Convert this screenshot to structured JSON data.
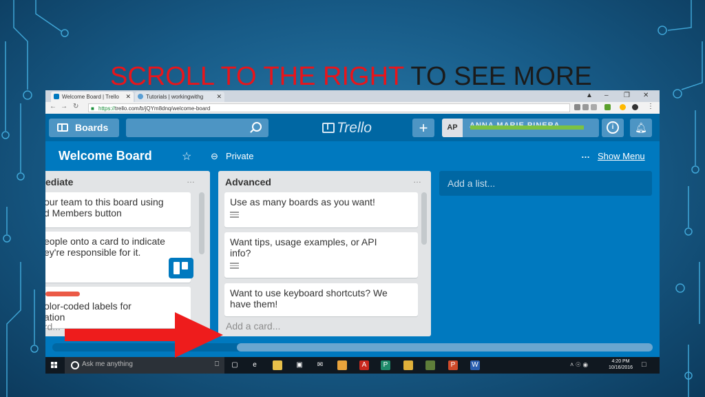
{
  "slide": {
    "title_red": "SCROLL TO THE RIGHT",
    "title_dark": " TO SEE MORE"
  },
  "browser": {
    "tabs": [
      {
        "label": "Welcome Board | Trello",
        "color": "#0079bf"
      },
      {
        "label": "Tutorials | workingwithg",
        "color": "#5a9fd4"
      }
    ],
    "url_scheme": "https://",
    "url_rest": "trello.com/b/jQYm8dnq/welcome-board",
    "window_controls": [
      "–",
      "❐",
      "✕"
    ]
  },
  "trello": {
    "boards_label": "Boards",
    "logo_text": "Trello",
    "plus_label": "+",
    "user_initials": "AP",
    "user_name": "ANNA MARIE PINERA",
    "info_label": "i",
    "bell_label": "⍾"
  },
  "board": {
    "title": "Welcome Board",
    "star": "☆",
    "lock": "ὑ2",
    "visibility": "Private",
    "menu_dots": "…",
    "show_menu": "Show Menu"
  },
  "lists": [
    {
      "title": "ediate",
      "menu": "…",
      "cards": [
        {
          "line1": "our team to this board using",
          "line2": "d Members button"
        },
        {
          "line1": "eople onto a card to indicate",
          "line2": "ey're responsible for it."
        },
        {
          "line1": "olor-coded labels for",
          "line2": "ation"
        }
      ],
      "add_card": "ard..."
    },
    {
      "title": "Advanced",
      "menu": "…",
      "cards": [
        {
          "text": "Use as many boards as you want!"
        },
        {
          "line1": "Want tips, usage examples, or API",
          "line2": "info?"
        },
        {
          "line1": "Want to use keyboard shortcuts? We",
          "line2": "have them!"
        }
      ],
      "add_card": "Add a card..."
    }
  ],
  "add_list": "Add a list...",
  "taskbar": {
    "search_placeholder": "Ask me anything",
    "mic": "⎕",
    "time": "4:20 PM",
    "date": "10/16/2016",
    "tray": "˄ ☉ ◉",
    "notif": "□",
    "apps": [
      {
        "name": "task-view",
        "color": "#101820",
        "glyph": "▢"
      },
      {
        "name": "edge",
        "color": "#101820",
        "glyph": "e"
      },
      {
        "name": "file-explorer",
        "color": "#e8c04a",
        "glyph": ""
      },
      {
        "name": "store",
        "color": "#101820",
        "glyph": "▣"
      },
      {
        "name": "mail",
        "color": "#101820",
        "glyph": "✉"
      },
      {
        "name": "app-orange",
        "color": "#e8a33c",
        "glyph": ""
      },
      {
        "name": "acrobat",
        "color": "#c8281e",
        "glyph": "A"
      },
      {
        "name": "publisher",
        "color": "#1e8a6a",
        "glyph": "P"
      },
      {
        "name": "chrome",
        "color": "#e0b03a",
        "glyph": ""
      },
      {
        "name": "app-bird",
        "color": "#5e7d3a",
        "glyph": ""
      },
      {
        "name": "powerpoint",
        "color": "#d04a2a",
        "glyph": "P"
      },
      {
        "name": "word",
        "color": "#2b5fb0",
        "glyph": "W"
      }
    ]
  },
  "colors": {
    "trello_blue": "#0079bf",
    "header_blue": "#0067a3",
    "title_red": "#e8151b",
    "arrow_red": "#ee1c1c",
    "highlight_green": "#7cc242"
  }
}
